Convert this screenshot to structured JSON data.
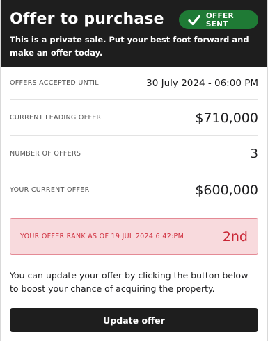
{
  "header": {
    "title": "Offer to purchase",
    "subtitle": "This is a private sale. Put your best foot forward and make an offer today.",
    "badge": {
      "label": "OFFER SENT",
      "icon": "check-icon",
      "color": "#1f7a35"
    }
  },
  "details": [
    {
      "label": "OFFERS ACCEPTED UNTIL",
      "value": "30 July 2024 - 06:00 PM"
    },
    {
      "label": "CURRENT LEADING OFFER",
      "value": "$710,000"
    },
    {
      "label": "NUMBER OF OFFERS",
      "value": "3"
    },
    {
      "label": "YOUR CURRENT OFFER",
      "value": "$600,000"
    }
  ],
  "rank": {
    "label": "YOUR OFFER RANK AS OF 19 JUL 2024 6:42:PM",
    "value": "2nd",
    "color": "#c92534"
  },
  "note": "You can update your offer by clicking the button below to boost your chance of acquiring the property.",
  "actions": {
    "update_label": "Update offer"
  }
}
